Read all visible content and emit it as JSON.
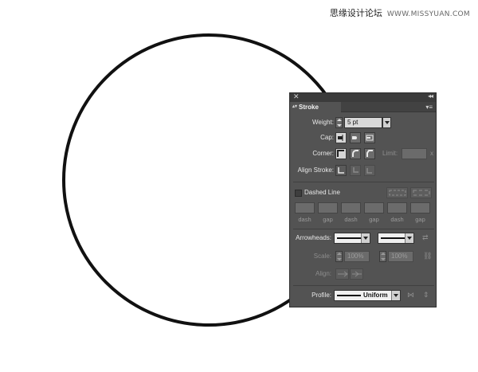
{
  "watermark": {
    "text": "思缘设计论坛",
    "site": "WWW.MISSYUAN.COM"
  },
  "panel": {
    "close_icon": "close-icon",
    "collapse_icon": "double-chevron-icon",
    "tab_label": "Stroke",
    "menu_icon": "panel-menu-icon",
    "weight": {
      "label": "Weight:",
      "value": "5 pt"
    },
    "cap": {
      "label": "Cap:"
    },
    "corner": {
      "label": "Corner:",
      "limit_label": "Limit:",
      "limit_unit": "x"
    },
    "align_stroke": {
      "label": "Align Stroke:"
    },
    "dashed_line": {
      "label": "Dashed Line",
      "checked": false
    },
    "dash_labels": [
      "dash",
      "gap",
      "dash",
      "gap",
      "dash",
      "gap"
    ],
    "arrowheads": {
      "label": "Arrowheads:"
    },
    "scale": {
      "label": "Scale:",
      "start": "100%",
      "end": "100%"
    },
    "align": {
      "label": "Align:"
    },
    "profile": {
      "label": "Profile:",
      "value": "Uniform"
    }
  }
}
